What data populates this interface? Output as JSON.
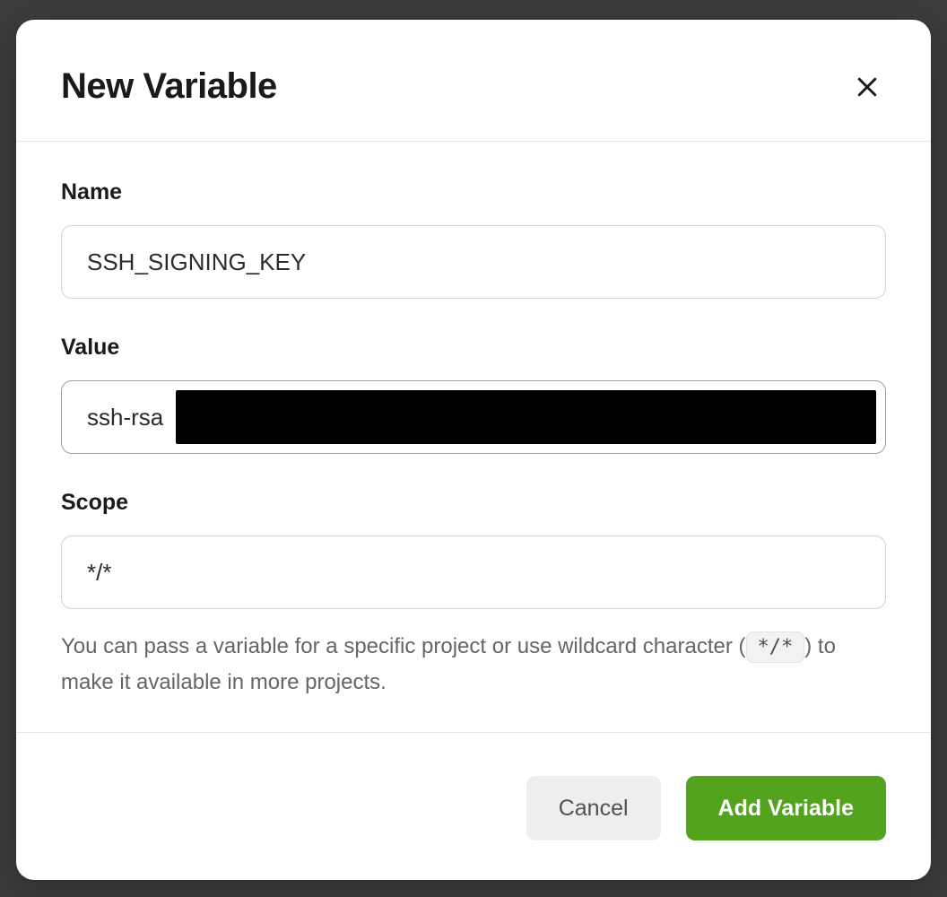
{
  "modal": {
    "title": "New Variable",
    "fields": {
      "name": {
        "label": "Name",
        "value": "SSH_SIGNING_KEY"
      },
      "value": {
        "label": "Value",
        "prefix": "ssh-rsa",
        "redacted": true
      },
      "scope": {
        "label": "Scope",
        "value": "*/*",
        "help_prefix": "You can pass a variable for a specific project or use wildcard character (",
        "help_code": "*/*",
        "help_suffix": ") to make it available in more projects."
      }
    },
    "actions": {
      "cancel": "Cancel",
      "submit": "Add Variable"
    }
  }
}
